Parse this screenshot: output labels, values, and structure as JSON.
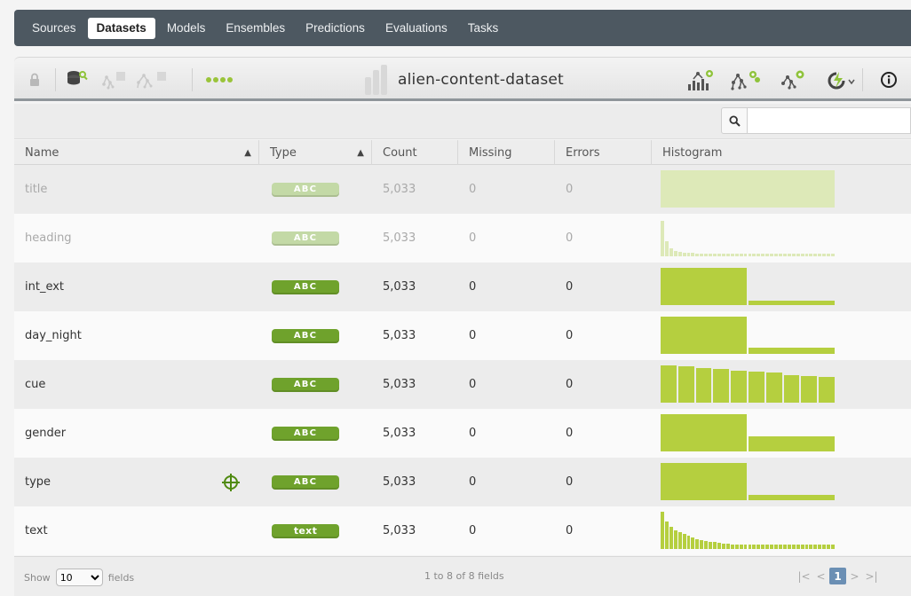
{
  "nav": {
    "items": [
      {
        "label": "Sources",
        "active": false
      },
      {
        "label": "Datasets",
        "active": true
      },
      {
        "label": "Models",
        "active": false
      },
      {
        "label": "Ensembles",
        "active": false
      },
      {
        "label": "Predictions",
        "active": false
      },
      {
        "label": "Evaluations",
        "active": false
      },
      {
        "label": "Tasks",
        "active": false
      }
    ]
  },
  "toolbar": {
    "dataset_name": "alien-content-dataset",
    "left_icons": [
      "lock-icon",
      "dataset-search-icon",
      "model-config-icon",
      "ensemble-config-icon",
      "more-dots-icon"
    ],
    "right_icons": [
      "configure-model-icon",
      "configure-ensemble-icon",
      "one-click-model-icon",
      "actions-dropdown-icon",
      "info-icon"
    ]
  },
  "search": {
    "placeholder": "",
    "value": "",
    "icon": "magnifier-icon"
  },
  "table": {
    "headers": {
      "name": "Name",
      "type": "Type",
      "count": "Count",
      "missing": "Missing",
      "errors": "Errors",
      "histogram": "Histogram"
    },
    "rows": [
      {
        "name": "title",
        "type": "ABC",
        "count": "5,033",
        "missing": "0",
        "errors": "0",
        "dim": true,
        "hist": [
          1.0
        ]
      },
      {
        "name": "heading",
        "type": "ABC",
        "count": "5,033",
        "missing": "0",
        "errors": "0",
        "dim": true,
        "hist": [
          0.95,
          0.4,
          0.22,
          0.15,
          0.12,
          0.1,
          0.09,
          0.09,
          0.08,
          0.08,
          0.08,
          0.08,
          0.08,
          0.08,
          0.08,
          0.08,
          0.08,
          0.08,
          0.08,
          0.08,
          0.08,
          0.08,
          0.08,
          0.08,
          0.08,
          0.08,
          0.08,
          0.08,
          0.08,
          0.08,
          0.08,
          0.08,
          0.08,
          0.08,
          0.08,
          0.08,
          0.08,
          0.08,
          0.08,
          0.08
        ]
      },
      {
        "name": "int_ext",
        "type": "ABC",
        "count": "5,033",
        "missing": "0",
        "errors": "0",
        "dim": false,
        "hist": [
          1.0,
          0.13
        ]
      },
      {
        "name": "day_night",
        "type": "ABC",
        "count": "5,033",
        "missing": "0",
        "errors": "0",
        "dim": false,
        "hist": [
          1.0,
          0.17
        ]
      },
      {
        "name": "cue",
        "type": "ABC",
        "count": "5,033",
        "missing": "0",
        "errors": "0",
        "dim": false,
        "hist": [
          1.0,
          0.98,
          0.93,
          0.9,
          0.86,
          0.83,
          0.8,
          0.74,
          0.71,
          0.68
        ]
      },
      {
        "name": "gender",
        "type": "ABC",
        "count": "5,033",
        "missing": "0",
        "errors": "0",
        "dim": false,
        "hist": [
          1.0,
          0.4
        ]
      },
      {
        "name": "type",
        "type": "ABC",
        "count": "5,033",
        "missing": "0",
        "errors": "0",
        "dim": false,
        "target": true,
        "hist": [
          1.0,
          0.14
        ]
      },
      {
        "name": "text",
        "type": "text",
        "count": "5,033",
        "missing": "0",
        "errors": "0",
        "dim": false,
        "hist": [
          1.0,
          0.75,
          0.6,
          0.5,
          0.45,
          0.4,
          0.35,
          0.3,
          0.27,
          0.25,
          0.22,
          0.2,
          0.18,
          0.16,
          0.15,
          0.14,
          0.13,
          0.13,
          0.13,
          0.13,
          0.13,
          0.13,
          0.13,
          0.13,
          0.13,
          0.13,
          0.13,
          0.13,
          0.13,
          0.13,
          0.13,
          0.13,
          0.13,
          0.13,
          0.13,
          0.13,
          0.13,
          0.13,
          0.13,
          0.13
        ]
      }
    ]
  },
  "footer": {
    "show_label": "Show",
    "page_size": "10",
    "fields_label": "fields",
    "info": "1 to 8 of 8 fields",
    "current_page": "1"
  },
  "colors": {
    "accent": "#6fa22c",
    "histogram": "#b5cf3f",
    "nav": "#4d5861"
  }
}
